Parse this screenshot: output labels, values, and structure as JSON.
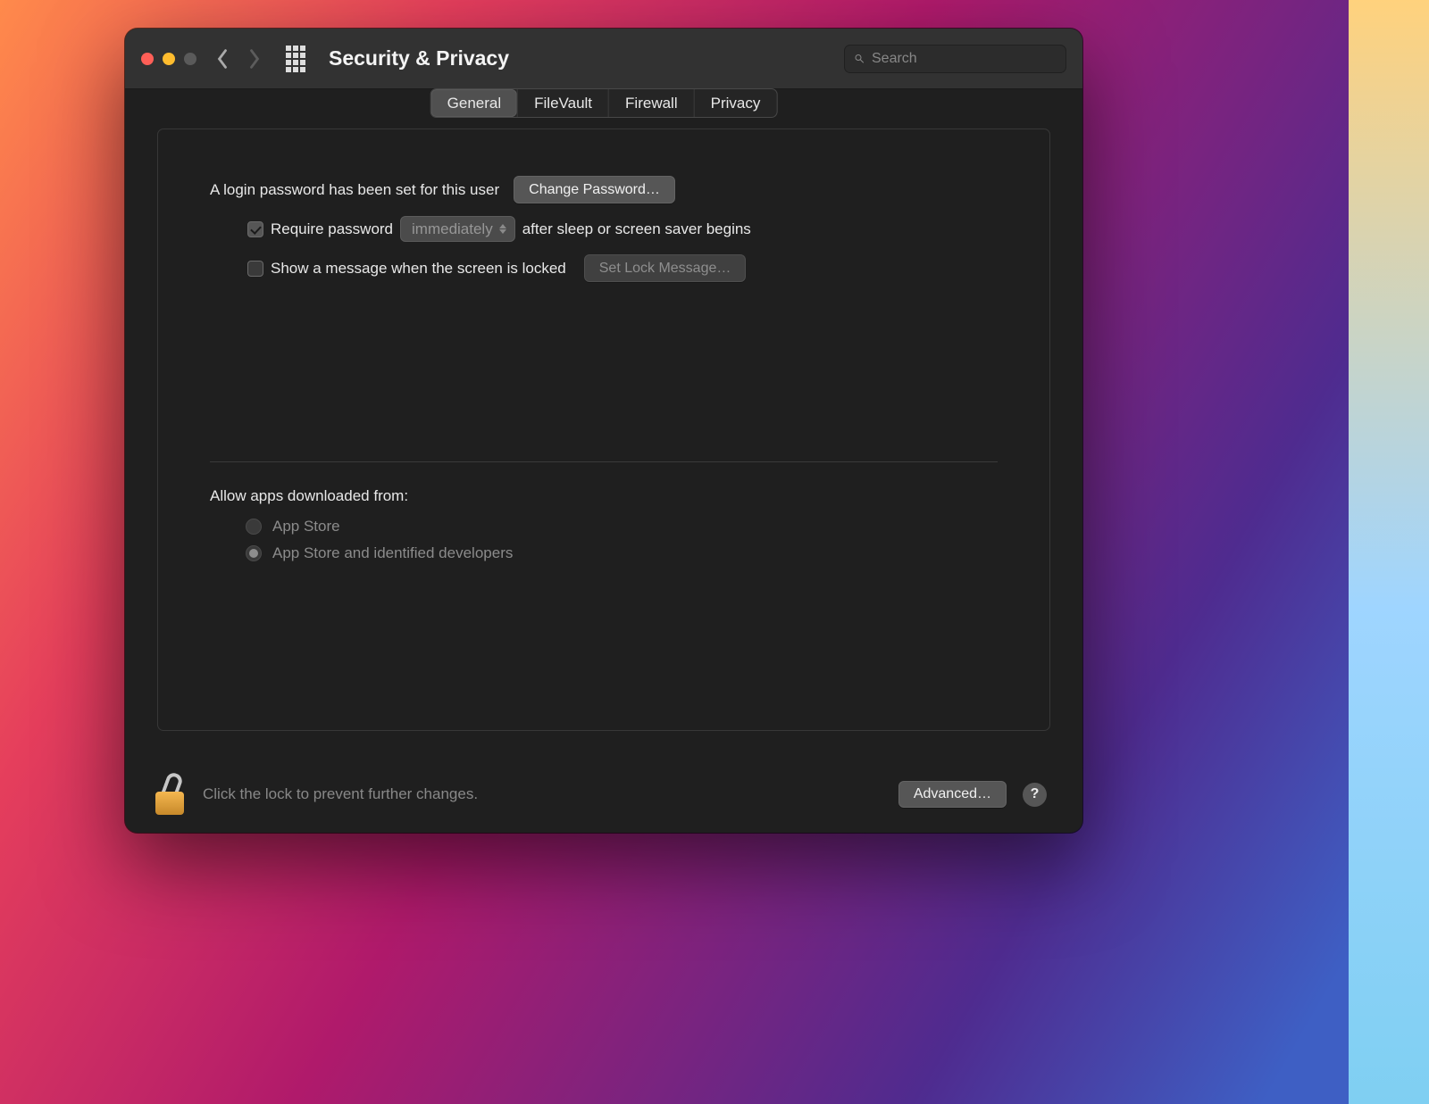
{
  "header": {
    "title": "Security & Privacy",
    "search_placeholder": "Search"
  },
  "tabs": {
    "general": "General",
    "filevault": "FileVault",
    "firewall": "Firewall",
    "privacy": "Privacy"
  },
  "general": {
    "login_password_set_text": "A login password has been set for this user",
    "change_password_button": "Change Password…",
    "require_password_prefix": "Require password",
    "require_password_delay_selected": "immediately",
    "require_password_suffix": "after sleep or screen saver begins",
    "show_lock_message_label": "Show a message when the screen is locked",
    "set_lock_message_button": "Set Lock Message…",
    "allow_apps_label": "Allow apps downloaded from:",
    "radio_app_store": "App Store",
    "radio_app_store_dev": "App Store and identified developers"
  },
  "footer": {
    "lock_text": "Click the lock to prevent further changes.",
    "advanced_button": "Advanced…",
    "help": "?"
  }
}
